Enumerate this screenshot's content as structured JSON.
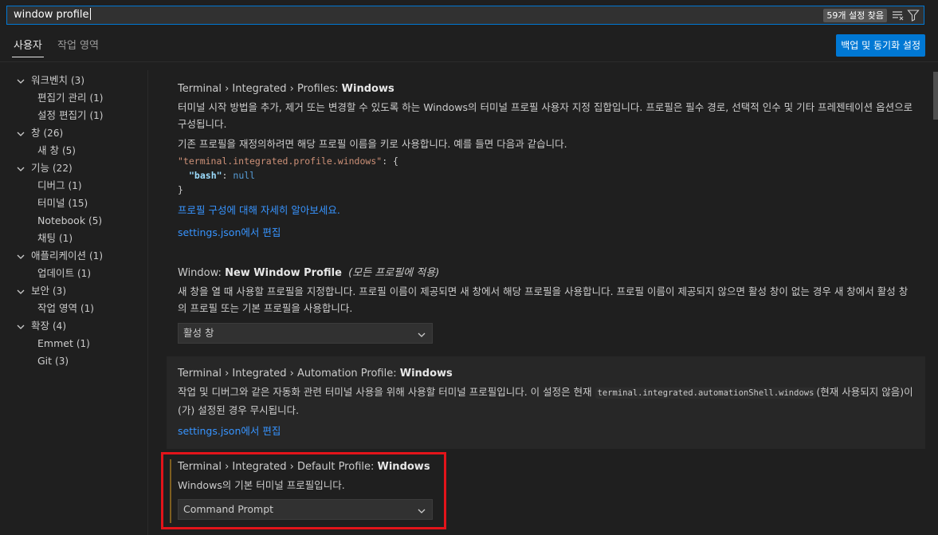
{
  "search": {
    "query": "window profile",
    "result_count": "59개 설정 찾음",
    "clear_filter_icon": "clear-filter-icon",
    "filter_icon": "filter-icon"
  },
  "tabs": {
    "user": "사용자",
    "workspace": "작업 영역",
    "sync_button": "백업 및 동기화 설정"
  },
  "toc": [
    {
      "label": "워크벤치",
      "count": "(3)",
      "expandable": true
    },
    {
      "label": "편집기 관리",
      "count": "(1)",
      "expandable": false
    },
    {
      "label": "설정 편집기",
      "count": "(1)",
      "expandable": false
    },
    {
      "label": "창",
      "count": "(26)",
      "expandable": true
    },
    {
      "label": "새 창",
      "count": "(5)",
      "expandable": false
    },
    {
      "label": "기능",
      "count": "(22)",
      "expandable": true
    },
    {
      "label": "디버그",
      "count": "(1)",
      "expandable": false
    },
    {
      "label": "터미널",
      "count": "(15)",
      "expandable": false
    },
    {
      "label": "Notebook",
      "count": "(5)",
      "expandable": false
    },
    {
      "label": "채팅",
      "count": "(1)",
      "expandable": false
    },
    {
      "label": "애플리케이션",
      "count": "(1)",
      "expandable": true
    },
    {
      "label": "업데이트",
      "count": "(1)",
      "expandable": false
    },
    {
      "label": "보안",
      "count": "(3)",
      "expandable": true
    },
    {
      "label": "작업 영역",
      "count": "(1)",
      "expandable": false
    },
    {
      "label": "확장",
      "count": "(4)",
      "expandable": true
    },
    {
      "label": "Emmet",
      "count": "(1)",
      "expandable": false
    },
    {
      "label": "Git",
      "count": "(3)",
      "expandable": false
    }
  ],
  "settings": {
    "profiles_windows": {
      "category": "Terminal › Integrated › Profiles: ",
      "key": "Windows",
      "desc1": "터미널 시작 방법을 추가, 제거 또는 변경할 수 있도록 하는 Windows의 터미널 프로필 사용자 지정 집합입니다. 프로필은 필수 경로, 선택적 인수 및 기타 프레젠테이션 옵션으로 구성됩니다.",
      "desc2": "기존 프로필을 재정의하려면 해당 프로필 이름을 키로 사용합니다. 예를 들면 다음과 같습니다.",
      "code_key": "\"terminal.integrated.profile.windows\"",
      "code_colon": ": {",
      "code_prop": "\"bash\"",
      "code_sep": ": ",
      "code_value": "null",
      "code_close": "}",
      "learn_more": "프로필 구성에 대해 자세히 알아보세요.",
      "edit_json": "settings.json에서 편집"
    },
    "new_window_profile": {
      "category": "Window: ",
      "key": "New Window Profile",
      "scope": "(모든 프로필에 적용)",
      "desc": "새 창을 열 때 사용할 프로필을 지정합니다. 프로필 이름이 제공되면 새 창에서 해당 프로필을 사용합니다. 프로필 이름이 제공되지 않으면 활성 창이 없는 경우 새 창에서 활성 창의 프로필 또는 기본 프로필을 사용합니다.",
      "value": "활성 창"
    },
    "automation_profile": {
      "category": "Terminal › Integrated › Automation Profile: ",
      "key": "Windows",
      "desc_pre": "작업 및 디버그와 같은 자동화 관련 터미널 사용을 위해 사용할 터미널 프로필입니다. 이 설정은 현재 ",
      "desc_code": "terminal.integrated.automationShell.windows",
      "desc_post": "(현재 사용되지 않음)이(가) 설정된 경우 무시됩니다.",
      "edit_json": "settings.json에서 편집"
    },
    "default_profile": {
      "category": "Terminal › Integrated › Default Profile: ",
      "key": "Windows",
      "desc": "Windows의 기본 터미널 프로필입니다.",
      "value": "Command Prompt"
    }
  },
  "colors": {
    "accent": "#0078d4",
    "link": "#3794ff",
    "highlight": "#e3141a"
  }
}
